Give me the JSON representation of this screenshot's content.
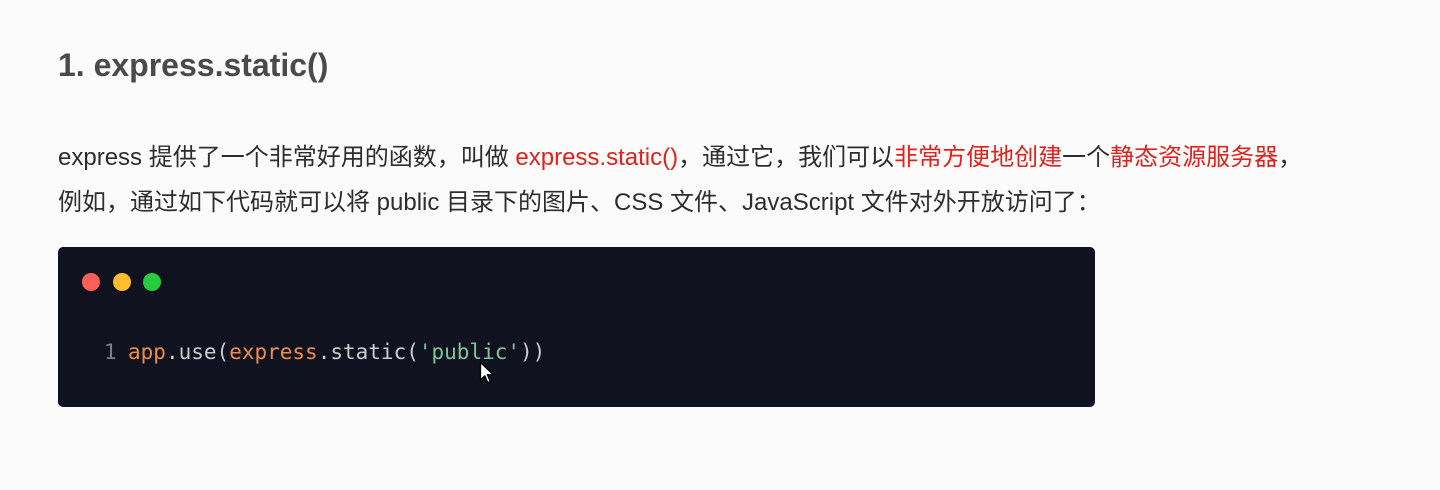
{
  "heading": {
    "text": "1. express.static()"
  },
  "intro": {
    "line_1": [
      {
        "text": "express 提供了一个非常好用的函数，叫做 ",
        "color": "#2d2d2d"
      },
      {
        "text": "express.static()",
        "color": "#e3211c"
      },
      {
        "text": "，通过它，我们可以",
        "color": "#2d2d2d"
      },
      {
        "text": "非常方便地创建",
        "color": "#e3211c"
      },
      {
        "text": "一个",
        "color": "#2d2d2d"
      },
      {
        "text": "静态资源服务器",
        "color": "#e3211c"
      },
      {
        "text": "，",
        "color": "#2d2d2d"
      }
    ],
    "line_2": "例如，通过如下代码就可以将 public 目录下的图片、CSS 文件、JavaScript 文件对外开放访问了："
  },
  "code_block": {
    "background": "#11121f",
    "window_dots": [
      "#ff5f56",
      "#ffbd2e",
      "#27c93f"
    ],
    "line_number": "1",
    "line_number_color": "#7b7d8a",
    "tokens": [
      {
        "text": "app",
        "color": "#f08d49"
      },
      {
        "text": ".",
        "color": "#cccccc"
      },
      {
        "text": "use",
        "color": "#cccccc"
      },
      {
        "text": "(",
        "color": "#cccccc"
      },
      {
        "text": "express",
        "color": "#f08d49"
      },
      {
        "text": ".",
        "color": "#cccccc"
      },
      {
        "text": "static",
        "color": "#cccccc"
      },
      {
        "text": "(",
        "color": "#cccccc"
      },
      {
        "text": "'public'",
        "color": "#7ec699"
      },
      {
        "text": "))",
        "color": "#cccccc"
      }
    ]
  },
  "cursor": {
    "icon": "mouse-pointer-icon"
  },
  "theme": {
    "page_background": "#fbfbfb",
    "heading_color": "#4a4a4a",
    "text_color": "#2d2d2d"
  }
}
